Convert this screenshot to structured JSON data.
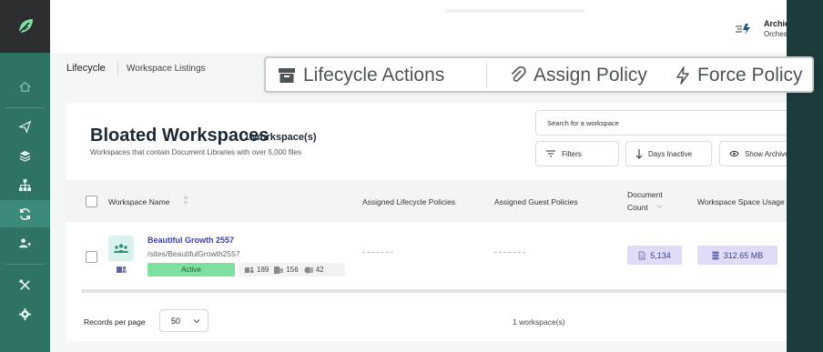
{
  "brand": {
    "logo_icon": "leaf-logo-icon",
    "accent": "#2f7266"
  },
  "sidebar": {
    "items": [
      {
        "name": "home",
        "icon": "home-icon"
      },
      {
        "name": "send",
        "icon": "send-icon"
      },
      {
        "name": "layers",
        "icon": "layers-icon"
      },
      {
        "name": "hierarchy",
        "icon": "hierarchy-icon"
      },
      {
        "name": "lifecycle",
        "icon": "refresh-icon",
        "active": true
      },
      {
        "name": "users",
        "icon": "users-icon"
      },
      {
        "name": "tools",
        "icon": "tools-icon"
      },
      {
        "name": "settings",
        "icon": "gear-icon"
      }
    ]
  },
  "user": {
    "name": "Archie",
    "org": "Orchestry Partneropol"
  },
  "breadcrumb": {
    "section": "Lifecycle",
    "page": "Workspace Listings"
  },
  "actions": {
    "lifecycle_actions": "Lifecycle Actions",
    "assign_policy": "Assign Policy",
    "force_policy": "Force Policy"
  },
  "card": {
    "title": "Bloated Workspaces",
    "count": "1 workspace(s)",
    "subtitle": "Workspaces that contain Document Libraries with over 5,000 files"
  },
  "search": {
    "placeholder": "Search for a workspace"
  },
  "controls": {
    "filters": "Filters",
    "days_inactive": "Days Inactive",
    "show_archived": "Show Archived"
  },
  "table": {
    "headers": {
      "workspace_name": "Workspace Name",
      "lifecycle_policies": "Assigned Lifecycle Policies",
      "guest_policies": "Assigned Guest Policies",
      "document_count_1": "Document",
      "document_count_2": "Count",
      "space_usage": "Workspace Space Usage"
    },
    "rows": [
      {
        "name": "Beautiful Growth 2557",
        "url": "/sites/BeautifulGrowth2557",
        "status": "Active",
        "stat_a": "189",
        "stat_b": "156",
        "stat_c": "42",
        "lifecycle_policies": "------",
        "guest_policies": "------",
        "document_count": "5,134",
        "space_usage": "312.65 MB"
      }
    ]
  },
  "footer": {
    "records_label": "Records per page",
    "records_value": "50",
    "total": "1 workspace(s)"
  }
}
